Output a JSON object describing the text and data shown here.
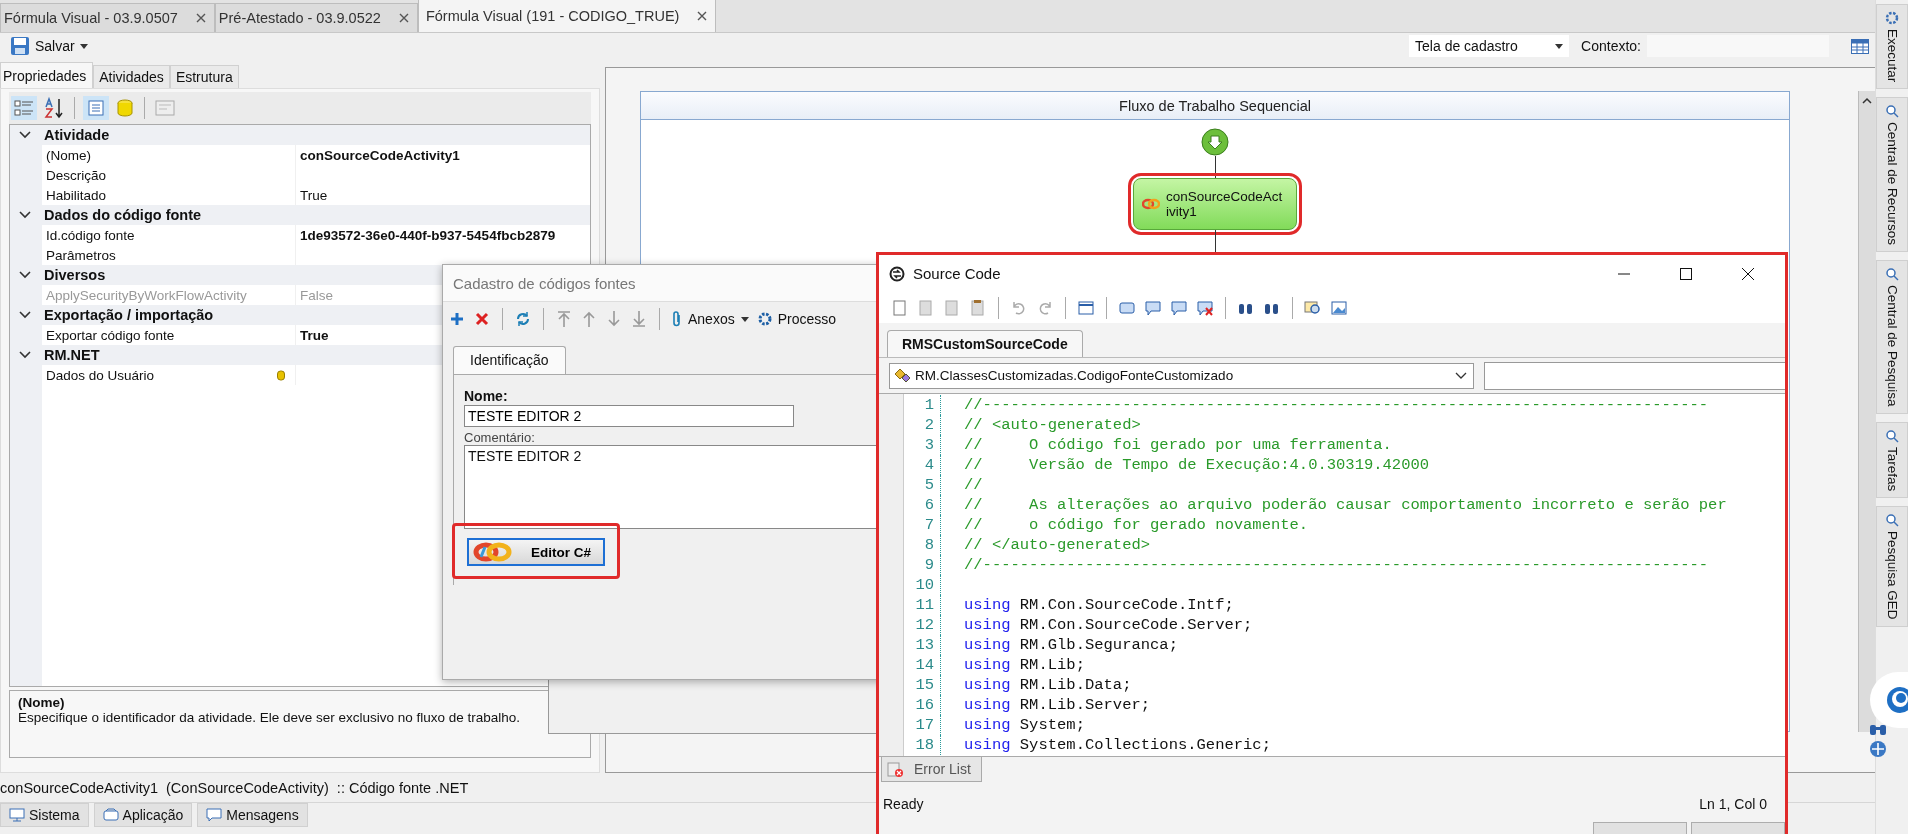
{
  "tabs": [
    {
      "label": "Fórmula Visual - 03.9.0507",
      "selected": false
    },
    {
      "label": "Pré-Atestado - 03.9.0522",
      "selected": false
    },
    {
      "label": "Fórmula Visual (191 - CODIGO_TRUE)",
      "selected": true
    }
  ],
  "toolbar": {
    "save_label": "Salvar",
    "screen_select": "Tela de cadastro",
    "context_label": "Contexto:"
  },
  "left_tabs": [
    {
      "label": "Propriedades",
      "selected": true
    },
    {
      "label": "Atividades",
      "selected": false
    },
    {
      "label": "Estrutura",
      "selected": false
    }
  ],
  "property_categories": [
    {
      "name": "Atividade",
      "expanded": true,
      "rows": [
        {
          "label": "(Nome)",
          "value": "conSourceCodeActivity1",
          "bold": true,
          "disabled": false,
          "kind": "text"
        },
        {
          "label": "Descrição",
          "disabled": false,
          "kind": "text"
        },
        {
          "label": "Habilitado",
          "value": "True",
          "bold": false,
          "disabled": false,
          "kind": "text"
        }
      ]
    },
    {
      "name": "Dados do código fonte",
      "expanded": true,
      "rows": [
        {
          "label": "Id.código fonte",
          "value": "1de93572-36e0-440f-b937-5454fbcb2879",
          "bold": true,
          "disabled": false,
          "kind": "text"
        },
        {
          "label": "Parâmetros",
          "disabled": false,
          "kind": "text"
        }
      ]
    },
    {
      "name": "Diversos",
      "expanded": true,
      "rows": [
        {
          "label": "ApplySecurityByWorkFlowActivity",
          "value": "False",
          "bold": false,
          "disabled": true,
          "kind": "text"
        }
      ]
    },
    {
      "name": "Exportação / importação",
      "expanded": true,
      "rows": [
        {
          "label": "Exportar código fonte",
          "value": "True",
          "bold": true,
          "disabled": false,
          "kind": "text"
        }
      ]
    },
    {
      "name": "RM.NET",
      "expanded": true,
      "rows": [
        {
          "label": "Dados do Usuário",
          "disabled": false,
          "kind": "data-link"
        }
      ]
    }
  ],
  "description": {
    "title": "(Nome)",
    "text": "Especifique o identificador da atividade. Ele deve ser exclusivo no fluxo de trabalho."
  },
  "designer": {
    "header": "Fluxo de Trabalho Sequencial",
    "activity": {
      "label_lines": [
        "conSourceCodeAct",
        "ivity1"
      ],
      "highlighted": true
    }
  },
  "status_line": "conSourceCodeActivity1  (ConSourceCodeActivity)  :: Código fonte .NET",
  "bottom_tabs": [
    {
      "label": "Sistema",
      "kind": "monitor"
    },
    {
      "label": "Aplicação",
      "kind": "app"
    },
    {
      "label": "Mensagens",
      "kind": "message"
    }
  ],
  "dock_tabs": [
    "Executar",
    "Central de Recursos",
    "Central de Pesquisa",
    "Tarefas",
    "Pesquisa GED"
  ],
  "dialog": {
    "title": "Cadastro de códigos fontes",
    "attachments_label": "Anexos",
    "processes_label": "Processo",
    "tabs": [
      {
        "label": "Identificação",
        "selected": true
      }
    ],
    "name_label": "Nome:",
    "name_value": "TESTE EDITOR 2",
    "comment_label": "Comentário:",
    "comment_value": "TESTE EDITOR 2",
    "editor_button": {
      "label": "Editor C#",
      "highlighted": true
    }
  },
  "source_window": {
    "title": "Source Code",
    "highlighted": true,
    "tabs": [
      {
        "label": "RMSCustomSourceCode",
        "selected": true
      }
    ],
    "class_select": "RM.ClassesCustomizadas.CodigoFonteCustomizado",
    "lines": [
      {
        "number": "1",
        "kind": "comment",
        "text": "//------------------------------------------------------------------------------"
      },
      {
        "number": "2",
        "kind": "comment",
        "text": "// <auto-generated>"
      },
      {
        "number": "3",
        "kind": "comment",
        "text": "//     O código foi gerado por uma ferramenta."
      },
      {
        "number": "4",
        "kind": "comment",
        "text": "//     Versão de Tempo de Execução:4.0.30319.42000"
      },
      {
        "number": "5",
        "kind": "comment",
        "text": "//"
      },
      {
        "number": "6",
        "kind": "comment",
        "text": "//     As alterações ao arquivo poderão causar comportamento incorreto e serão per"
      },
      {
        "number": "7",
        "kind": "comment",
        "text": "//     o código for gerado novamente."
      },
      {
        "number": "8",
        "kind": "comment",
        "text": "// </auto-generated>"
      },
      {
        "number": "9",
        "kind": "comment",
        "text": "//------------------------------------------------------------------------------"
      },
      {
        "number": "10",
        "kind": "blank"
      },
      {
        "number": "11",
        "kind": "code",
        "keyword": "using",
        "text": "RM.Con.SourceCode.Intf;"
      },
      {
        "number": "12",
        "kind": "code",
        "keyword": "using",
        "text": "RM.Con.SourceCode.Server;"
      },
      {
        "number": "13",
        "kind": "code",
        "keyword": "using",
        "text": "RM.Glb.Seguranca;"
      },
      {
        "number": "14",
        "kind": "code",
        "keyword": "using",
        "text": "RM.Lib;"
      },
      {
        "number": "15",
        "kind": "code",
        "keyword": "using",
        "text": "RM.Lib.Data;"
      },
      {
        "number": "16",
        "kind": "code",
        "keyword": "using",
        "text": "RM.Lib.Server;"
      },
      {
        "number": "17",
        "kind": "code",
        "keyword": "using",
        "text": "System;"
      },
      {
        "number": "18",
        "kind": "code",
        "keyword": "using",
        "text": "System.Collections.Generic;"
      }
    ],
    "error_tab": "Error List",
    "status": "Ready",
    "position": "Ln 1, Col 0"
  }
}
